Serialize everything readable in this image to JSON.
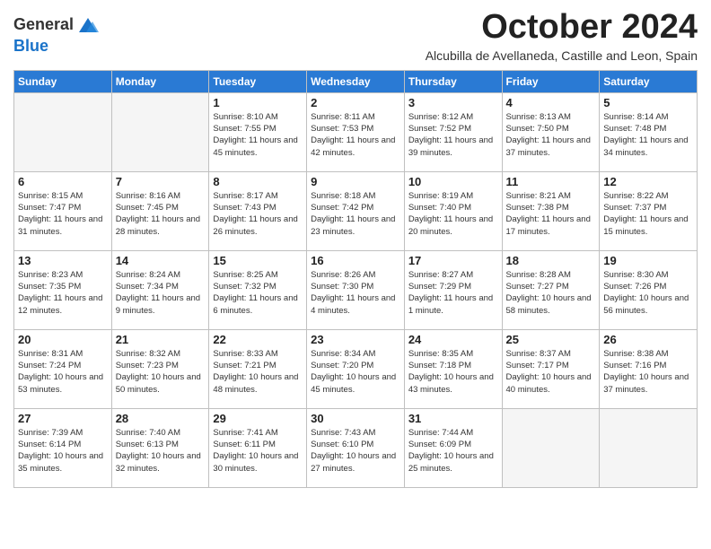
{
  "header": {
    "logo_line1": "General",
    "logo_line2": "Blue",
    "month_title": "October 2024",
    "subtitle": "Alcubilla de Avellaneda, Castille and Leon, Spain"
  },
  "weekdays": [
    "Sunday",
    "Monday",
    "Tuesday",
    "Wednesday",
    "Thursday",
    "Friday",
    "Saturday"
  ],
  "weeks": [
    [
      {
        "day": "",
        "empty": true
      },
      {
        "day": "",
        "empty": true
      },
      {
        "day": "1",
        "sunrise": "8:10 AM",
        "sunset": "7:55 PM",
        "daylight": "11 hours and 45 minutes."
      },
      {
        "day": "2",
        "sunrise": "8:11 AM",
        "sunset": "7:53 PM",
        "daylight": "11 hours and 42 minutes."
      },
      {
        "day": "3",
        "sunrise": "8:12 AM",
        "sunset": "7:52 PM",
        "daylight": "11 hours and 39 minutes."
      },
      {
        "day": "4",
        "sunrise": "8:13 AM",
        "sunset": "7:50 PM",
        "daylight": "11 hours and 37 minutes."
      },
      {
        "day": "5",
        "sunrise": "8:14 AM",
        "sunset": "7:48 PM",
        "daylight": "11 hours and 34 minutes."
      }
    ],
    [
      {
        "day": "6",
        "sunrise": "8:15 AM",
        "sunset": "7:47 PM",
        "daylight": "11 hours and 31 minutes."
      },
      {
        "day": "7",
        "sunrise": "8:16 AM",
        "sunset": "7:45 PM",
        "daylight": "11 hours and 28 minutes."
      },
      {
        "day": "8",
        "sunrise": "8:17 AM",
        "sunset": "7:43 PM",
        "daylight": "11 hours and 26 minutes."
      },
      {
        "day": "9",
        "sunrise": "8:18 AM",
        "sunset": "7:42 PM",
        "daylight": "11 hours and 23 minutes."
      },
      {
        "day": "10",
        "sunrise": "8:19 AM",
        "sunset": "7:40 PM",
        "daylight": "11 hours and 20 minutes."
      },
      {
        "day": "11",
        "sunrise": "8:21 AM",
        "sunset": "7:38 PM",
        "daylight": "11 hours and 17 minutes."
      },
      {
        "day": "12",
        "sunrise": "8:22 AM",
        "sunset": "7:37 PM",
        "daylight": "11 hours and 15 minutes."
      }
    ],
    [
      {
        "day": "13",
        "sunrise": "8:23 AM",
        "sunset": "7:35 PM",
        "daylight": "11 hours and 12 minutes."
      },
      {
        "day": "14",
        "sunrise": "8:24 AM",
        "sunset": "7:34 PM",
        "daylight": "11 hours and 9 minutes."
      },
      {
        "day": "15",
        "sunrise": "8:25 AM",
        "sunset": "7:32 PM",
        "daylight": "11 hours and 6 minutes."
      },
      {
        "day": "16",
        "sunrise": "8:26 AM",
        "sunset": "7:30 PM",
        "daylight": "11 hours and 4 minutes."
      },
      {
        "day": "17",
        "sunrise": "8:27 AM",
        "sunset": "7:29 PM",
        "daylight": "11 hours and 1 minute."
      },
      {
        "day": "18",
        "sunrise": "8:28 AM",
        "sunset": "7:27 PM",
        "daylight": "10 hours and 58 minutes."
      },
      {
        "day": "19",
        "sunrise": "8:30 AM",
        "sunset": "7:26 PM",
        "daylight": "10 hours and 56 minutes."
      }
    ],
    [
      {
        "day": "20",
        "sunrise": "8:31 AM",
        "sunset": "7:24 PM",
        "daylight": "10 hours and 53 minutes."
      },
      {
        "day": "21",
        "sunrise": "8:32 AM",
        "sunset": "7:23 PM",
        "daylight": "10 hours and 50 minutes."
      },
      {
        "day": "22",
        "sunrise": "8:33 AM",
        "sunset": "7:21 PM",
        "daylight": "10 hours and 48 minutes."
      },
      {
        "day": "23",
        "sunrise": "8:34 AM",
        "sunset": "7:20 PM",
        "daylight": "10 hours and 45 minutes."
      },
      {
        "day": "24",
        "sunrise": "8:35 AM",
        "sunset": "7:18 PM",
        "daylight": "10 hours and 43 minutes."
      },
      {
        "day": "25",
        "sunrise": "8:37 AM",
        "sunset": "7:17 PM",
        "daylight": "10 hours and 40 minutes."
      },
      {
        "day": "26",
        "sunrise": "8:38 AM",
        "sunset": "7:16 PM",
        "daylight": "10 hours and 37 minutes."
      }
    ],
    [
      {
        "day": "27",
        "sunrise": "7:39 AM",
        "sunset": "6:14 PM",
        "daylight": "10 hours and 35 minutes."
      },
      {
        "day": "28",
        "sunrise": "7:40 AM",
        "sunset": "6:13 PM",
        "daylight": "10 hours and 32 minutes."
      },
      {
        "day": "29",
        "sunrise": "7:41 AM",
        "sunset": "6:11 PM",
        "daylight": "10 hours and 30 minutes."
      },
      {
        "day": "30",
        "sunrise": "7:43 AM",
        "sunset": "6:10 PM",
        "daylight": "10 hours and 27 minutes."
      },
      {
        "day": "31",
        "sunrise": "7:44 AM",
        "sunset": "6:09 PM",
        "daylight": "10 hours and 25 minutes."
      },
      {
        "day": "",
        "empty": true
      },
      {
        "day": "",
        "empty": true
      }
    ]
  ]
}
